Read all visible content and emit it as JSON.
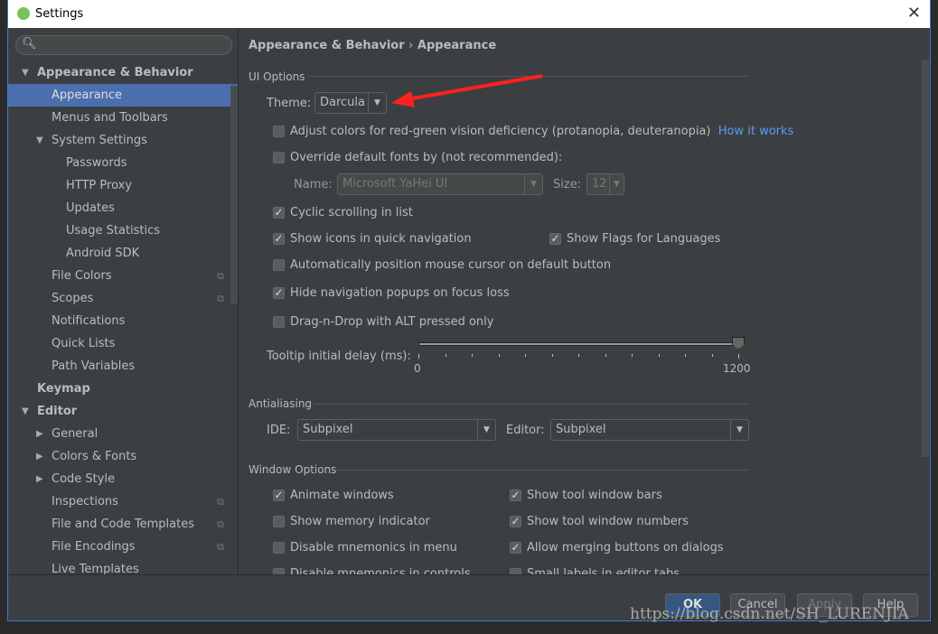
{
  "window": {
    "title": "Settings"
  },
  "sidebar": {
    "items": [
      {
        "label": "Appearance & Behavior",
        "level": 0,
        "bold": true,
        "expanded": true
      },
      {
        "label": "Appearance",
        "level": 1,
        "selected": true
      },
      {
        "label": "Menus and Toolbars",
        "level": 1
      },
      {
        "label": "System Settings",
        "level": 1,
        "expanded": true
      },
      {
        "label": "Passwords",
        "level": 2
      },
      {
        "label": "HTTP Proxy",
        "level": 2
      },
      {
        "label": "Updates",
        "level": 2
      },
      {
        "label": "Usage Statistics",
        "level": 2
      },
      {
        "label": "Android SDK",
        "level": 2
      },
      {
        "label": "File Colors",
        "level": 1,
        "copy": true
      },
      {
        "label": "Scopes",
        "level": 1,
        "copy": true
      },
      {
        "label": "Notifications",
        "level": 1
      },
      {
        "label": "Quick Lists",
        "level": 1
      },
      {
        "label": "Path Variables",
        "level": 1
      },
      {
        "label": "Keymap",
        "level": 0,
        "bold": true
      },
      {
        "label": "Editor",
        "level": 0,
        "bold": true,
        "expanded": true
      },
      {
        "label": "General",
        "level": 1,
        "collapsed": true
      },
      {
        "label": "Colors & Fonts",
        "level": 1,
        "collapsed": true
      },
      {
        "label": "Code Style",
        "level": 1,
        "collapsed": true
      },
      {
        "label": "Inspections",
        "level": 1,
        "copy": true
      },
      {
        "label": "File and Code Templates",
        "level": 1,
        "copy": true
      },
      {
        "label": "File Encodings",
        "level": 1,
        "copy": true
      },
      {
        "label": "Live Templates",
        "level": 1
      }
    ]
  },
  "breadcrumb": {
    "parent": "Appearance & Behavior",
    "sep": "›",
    "current": "Appearance"
  },
  "ui_options": {
    "title": "UI Options",
    "theme_label": "Theme:",
    "theme_value": "Darcula",
    "adjust_colors": "Adjust colors for red-green vision deficiency (protanopia, deuteranopia)",
    "how_it_works": "How it works",
    "override_fonts": "Override default fonts by (not recommended):",
    "name_label": "Name:",
    "name_value": "Microsoft YaHei UI",
    "size_label": "Size:",
    "size_value": "12",
    "cyclic": "Cyclic scrolling in list",
    "show_icons": "Show icons in quick navigation",
    "show_flags": "Show Flags for Languages",
    "auto_mouse": "Automatically position mouse cursor on default button",
    "hide_popups": "Hide navigation popups on focus loss",
    "dnd_alt": "Drag-n-Drop with ALT pressed only",
    "tooltip_label": "Tooltip initial delay (ms):",
    "tooltip_min": "0",
    "tooltip_max": "1200",
    "tooltip_value": 1200
  },
  "antialiasing": {
    "title": "Antialiasing",
    "ide_label": "IDE:",
    "ide_value": "Subpixel",
    "editor_label": "Editor:",
    "editor_value": "Subpixel"
  },
  "window_options": {
    "title": "Window Options",
    "items": [
      {
        "label": "Animate windows",
        "checked": true
      },
      {
        "label": "Show tool window bars",
        "checked": true
      },
      {
        "label": "Show memory indicator",
        "checked": false
      },
      {
        "label": "Show tool window numbers",
        "checked": true
      },
      {
        "label": "Disable mnemonics in menu",
        "checked": false
      },
      {
        "label": "Allow merging buttons on dialogs",
        "checked": true
      },
      {
        "label": "Disable mnemonics in controls",
        "checked": false
      },
      {
        "label": "Small labels in editor tabs",
        "checked": false
      }
    ]
  },
  "buttons": {
    "ok": "OK",
    "cancel": "Cancel",
    "apply": "Apply",
    "help": "Help"
  },
  "watermark": "https://blog.csdn.net/SH_LURENJIA",
  "colors": {
    "accent": "#4b6eaf",
    "link": "#589df6",
    "arrow": "#ff2020"
  }
}
